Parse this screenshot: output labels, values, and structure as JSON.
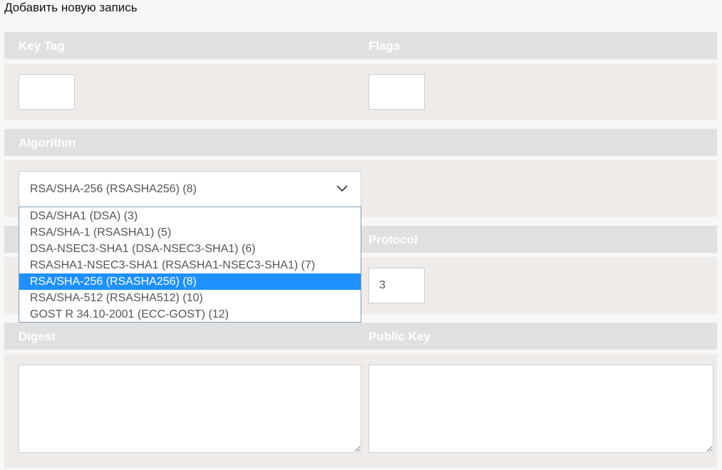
{
  "page": {
    "title": "Добавить новую запись"
  },
  "fields": {
    "key_tag": {
      "label": "Key Tag",
      "value": ""
    },
    "flags": {
      "label": "Flags",
      "value": ""
    },
    "algorithm": {
      "label": "Algorithm",
      "selected": "RSA/SHA-256 (RSASHA256) (8)",
      "options": [
        "DSA/SHA1 (DSA) (3)",
        "RSA/SHA-1 (RSASHA1) (5)",
        "DSA-NSEC3-SHA1 (DSA-NSEC3-SHA1) (6)",
        "RSASHA1-NSEC3-SHA1 (RSASHA1-NSEC3-SHA1) (7)",
        "RSA/SHA-256 (RSASHA256) (8)",
        "RSA/SHA-512 (RSASHA512) (10)",
        "GOST R 34.10-2001 (ECC-GOST) (12)"
      ]
    },
    "protocol": {
      "label": "Protocol",
      "value": "3"
    },
    "digest": {
      "label": "Digest",
      "value": ""
    },
    "public_key": {
      "label": "Public Key",
      "value": ""
    }
  },
  "icons": {
    "select_toggle": "chevron-down-icon"
  },
  "colors": {
    "selected_option_bg": "#1e90ff",
    "header_bar_bg": "#e0e0e0",
    "panel_bg": "#efebe8"
  }
}
